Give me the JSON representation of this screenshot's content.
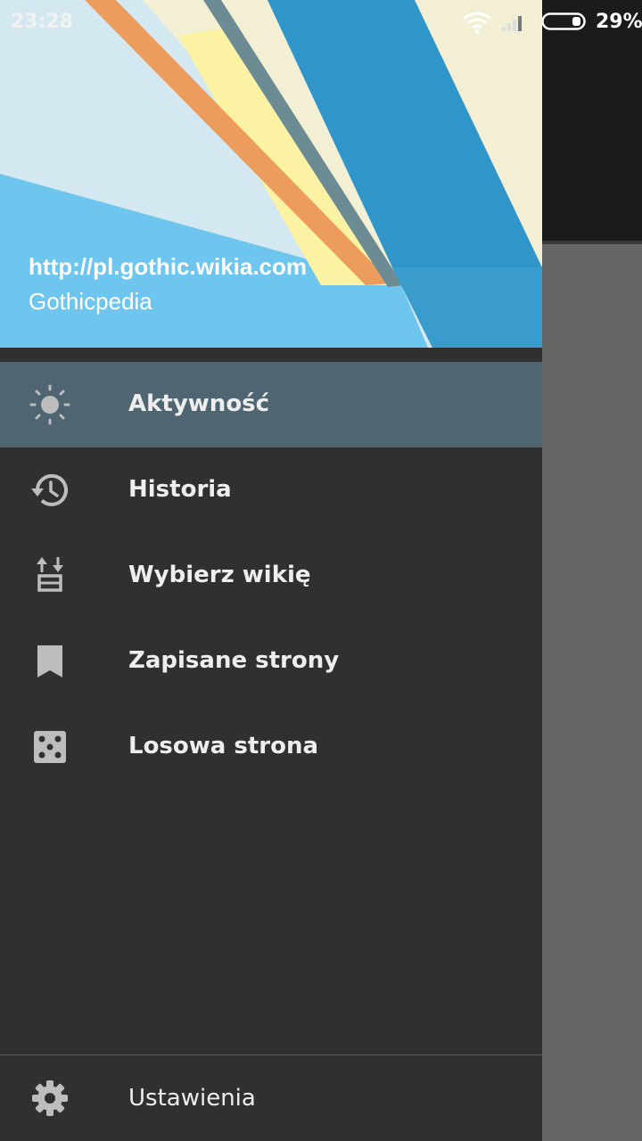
{
  "status_bar": {
    "time": "23:28",
    "battery": "29%",
    "icons": [
      "wifi-icon",
      "signal-icon",
      "battery-icon"
    ]
  },
  "drawer": {
    "header": {
      "url": "http://pl.gothic.wikia.com",
      "name": "Gothicpedia"
    },
    "items": [
      {
        "label": "Aktywność",
        "icon": "sun-icon",
        "active": true
      },
      {
        "label": "Historia",
        "icon": "history-icon",
        "active": false
      },
      {
        "label": "Wybierz wikię",
        "icon": "swap-wiki-icon",
        "active": false
      },
      {
        "label": "Zapisane strony",
        "icon": "bookmark-icon",
        "active": false
      },
      {
        "label": "Losowa strona",
        "icon": "dice-icon",
        "active": false
      }
    ],
    "settings": {
      "label": "Ustawienia",
      "icon": "gear-icon"
    }
  },
  "colors": {
    "drawer_bg": "#303030",
    "active_item_bg": "#4f6571",
    "scrim": "#666666",
    "icon_gray": "#bdbdbd"
  }
}
